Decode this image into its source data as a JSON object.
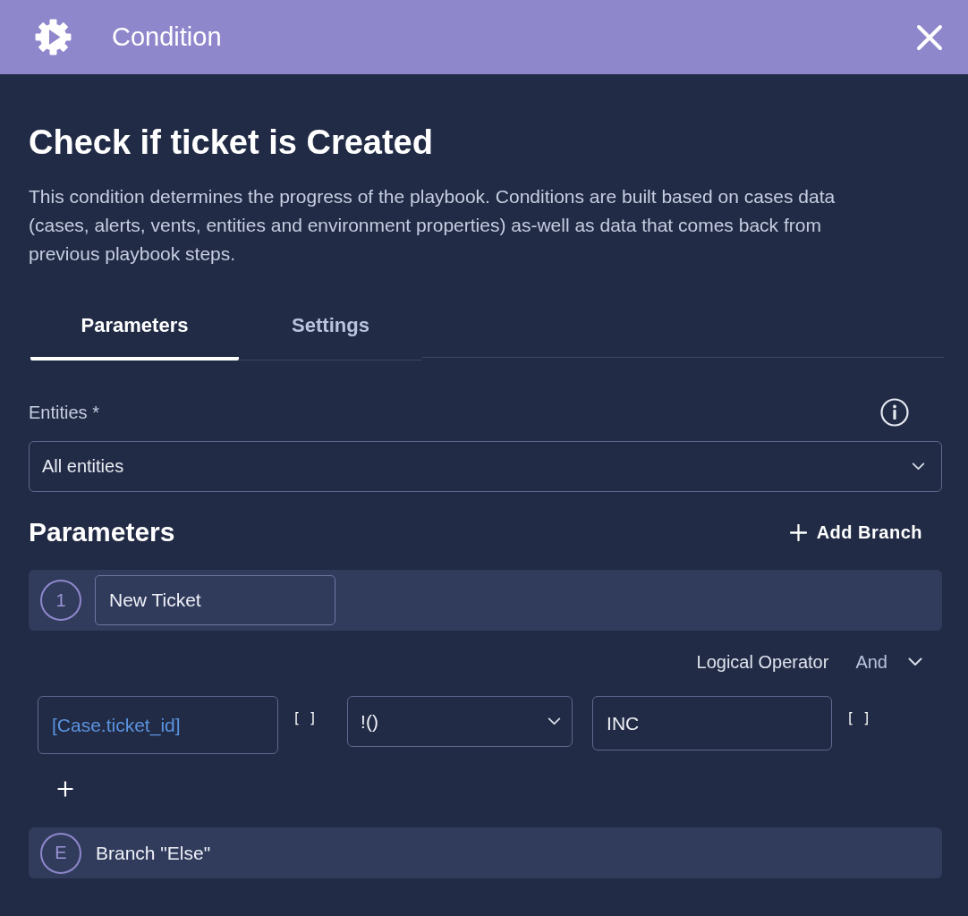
{
  "header": {
    "title": "Condition"
  },
  "heading": "Check if ticket is Created",
  "description": "This condition determines the progress of the playbook. Conditions are built based on cases data (cases, alerts, vents, entities and environment properties) as-well as data that comes back from previous playbook steps.",
  "tabs": [
    {
      "label": "Parameters",
      "selected": true
    },
    {
      "label": "Settings",
      "selected": false
    }
  ],
  "entities_field": {
    "label": "Entities *",
    "value": "All entities"
  },
  "parameters": {
    "title": "Parameters",
    "add_branch": "Add Branch",
    "branches": [
      {
        "kind": "condition",
        "badge": "1",
        "name": "New Ticket",
        "logical_operator": {
          "label": "Logical Operator",
          "value": "And"
        },
        "conditions": [
          {
            "field": "[Case.ticket_id]",
            "field_bracket": "[ ]",
            "operator": "!()",
            "value": "INC",
            "value_bracket": "[ ]"
          }
        ]
      },
      {
        "kind": "else",
        "badge": "E",
        "label": "Branch \"Else\""
      }
    ]
  }
}
